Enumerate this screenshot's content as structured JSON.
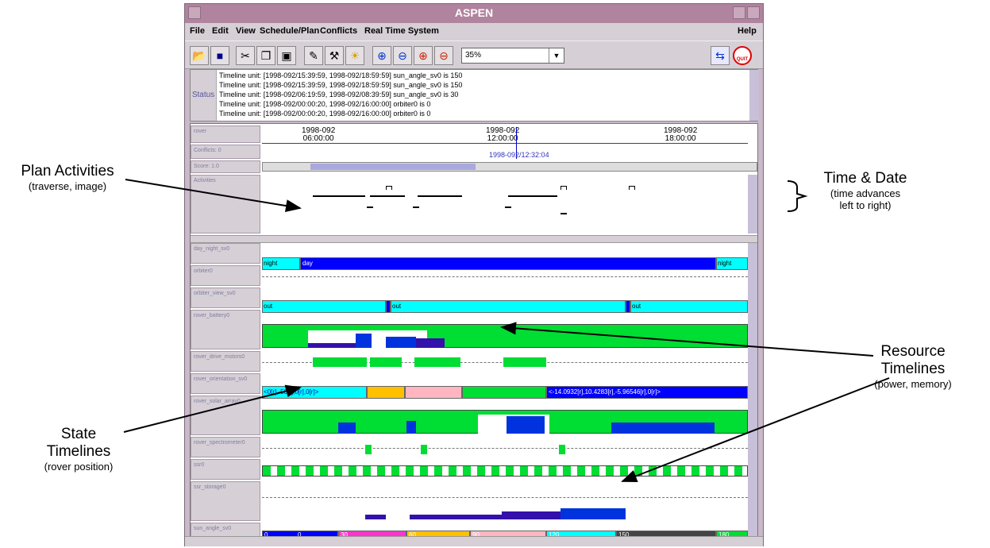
{
  "window": {
    "title": "ASPEN",
    "menu": [
      "File",
      "Edit",
      "View",
      "Schedule/Plan",
      "Conflicts",
      "Real Time System"
    ],
    "help": "Help"
  },
  "toolbar": {
    "zoom_value": "35%",
    "exit_label": "QUIT"
  },
  "status": {
    "label": "Status",
    "lines": [
      "Timeline unit: [1998-092/15:39:59, 1998-092/18:59:59] sun_angle_sv0 is 150",
      "Timeline unit: [1998-092/15:39:59, 1998-092/18:59:59] sun_angle_sv0 is 150",
      "Timeline unit: [1998-092/06:19:59, 1998-092/08:39:59] sun_angle_sv0 is 30",
      "Timeline unit: [1998-092/00:00:20, 1998-092/16:00:00] orbiter0 is 0",
      "Timeline unit: [1998-092/00:00:20, 1998-092/16:00:00] orbiter0 is 0"
    ]
  },
  "time_header": {
    "left_labels": [
      "rover",
      "Conflicts: 0",
      "Score: 1.0"
    ],
    "ticks": [
      {
        "date": "1998-092",
        "time": "06:00:00"
      },
      {
        "date": "1998-092",
        "time": "12:00:00"
      },
      {
        "date": "1998-092",
        "time": "18:00:00"
      }
    ],
    "current_time": "1998-092/12:32:04"
  },
  "activities_label": "Activities",
  "timelines": [
    {
      "label": "day_night_sv0",
      "segments": [
        "night",
        "day",
        "night"
      ]
    },
    {
      "label": "orbiter0"
    },
    {
      "label": "orbiter_view_sv0",
      "segments": [
        "out",
        "out",
        "out"
      ]
    },
    {
      "label": "rover_battery0"
    },
    {
      "label": "rover_drive_motors0"
    },
    {
      "label": "rover_orientation_sv0",
      "segments": [
        "<0[r],-50[r],0[r],0[r]>",
        "<-14.0932[r],10.4283[r],-5.96546[r],0[r]>"
      ]
    },
    {
      "label": "rover_solar_array0"
    },
    {
      "label": "rover_spectrometer0"
    },
    {
      "label": "ssr0"
    },
    {
      "label": "ssr_storage0"
    },
    {
      "label": "sun_angle_sv0",
      "segments": [
        "0",
        "0",
        "30",
        "60",
        "90",
        "120",
        "150",
        "180"
      ]
    }
  ],
  "annotations": {
    "plan_title": "Plan Activities",
    "plan_sub": "(traverse, image)",
    "time_title": "Time & Date",
    "time_sub1": "(time advances",
    "time_sub2": "left to right)",
    "resource_title1": "Resource",
    "resource_title2": "Timelines",
    "resource_sub": "(power, memory)",
    "state_title1": "State",
    "state_title2": "Timelines",
    "state_sub": "(rover position)"
  },
  "colors": {
    "title_bar": "#b0839e",
    "window_bg": "#c9b9c9",
    "blue": "#0000ff",
    "cyan": "#00ffff",
    "green": "#00dd33",
    "navy": "#3311aa",
    "magenta": "#ff33cc",
    "orange": "#ffc000",
    "pink": "#ffb6c1"
  }
}
